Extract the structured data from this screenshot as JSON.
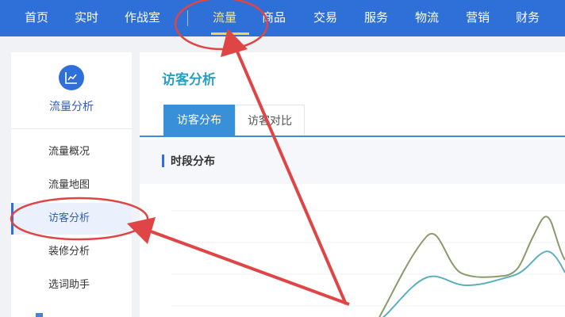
{
  "topnav": {
    "items": [
      "首页",
      "实时",
      "作战室",
      "流量",
      "商品",
      "交易",
      "服务",
      "物流",
      "营销",
      "财务"
    ],
    "active_index": 3
  },
  "sidebar": {
    "icon": "line-chart-icon",
    "title": "流量分析",
    "items": [
      "流量概况",
      "流量地图",
      "访客分析",
      "装修分析",
      "选词助手"
    ],
    "active_index": 2
  },
  "main": {
    "title": "访客分析",
    "tabs": [
      "访客分布",
      "访客对比"
    ],
    "active_tab": 0,
    "section_title": "时段分布"
  },
  "colors": {
    "nav_bg": "#2f6fd8",
    "accent": "#3a8fd9",
    "series_olive": "#8b9a6b",
    "series_teal": "#5bb0c0",
    "annotation": "#e04545"
  }
}
